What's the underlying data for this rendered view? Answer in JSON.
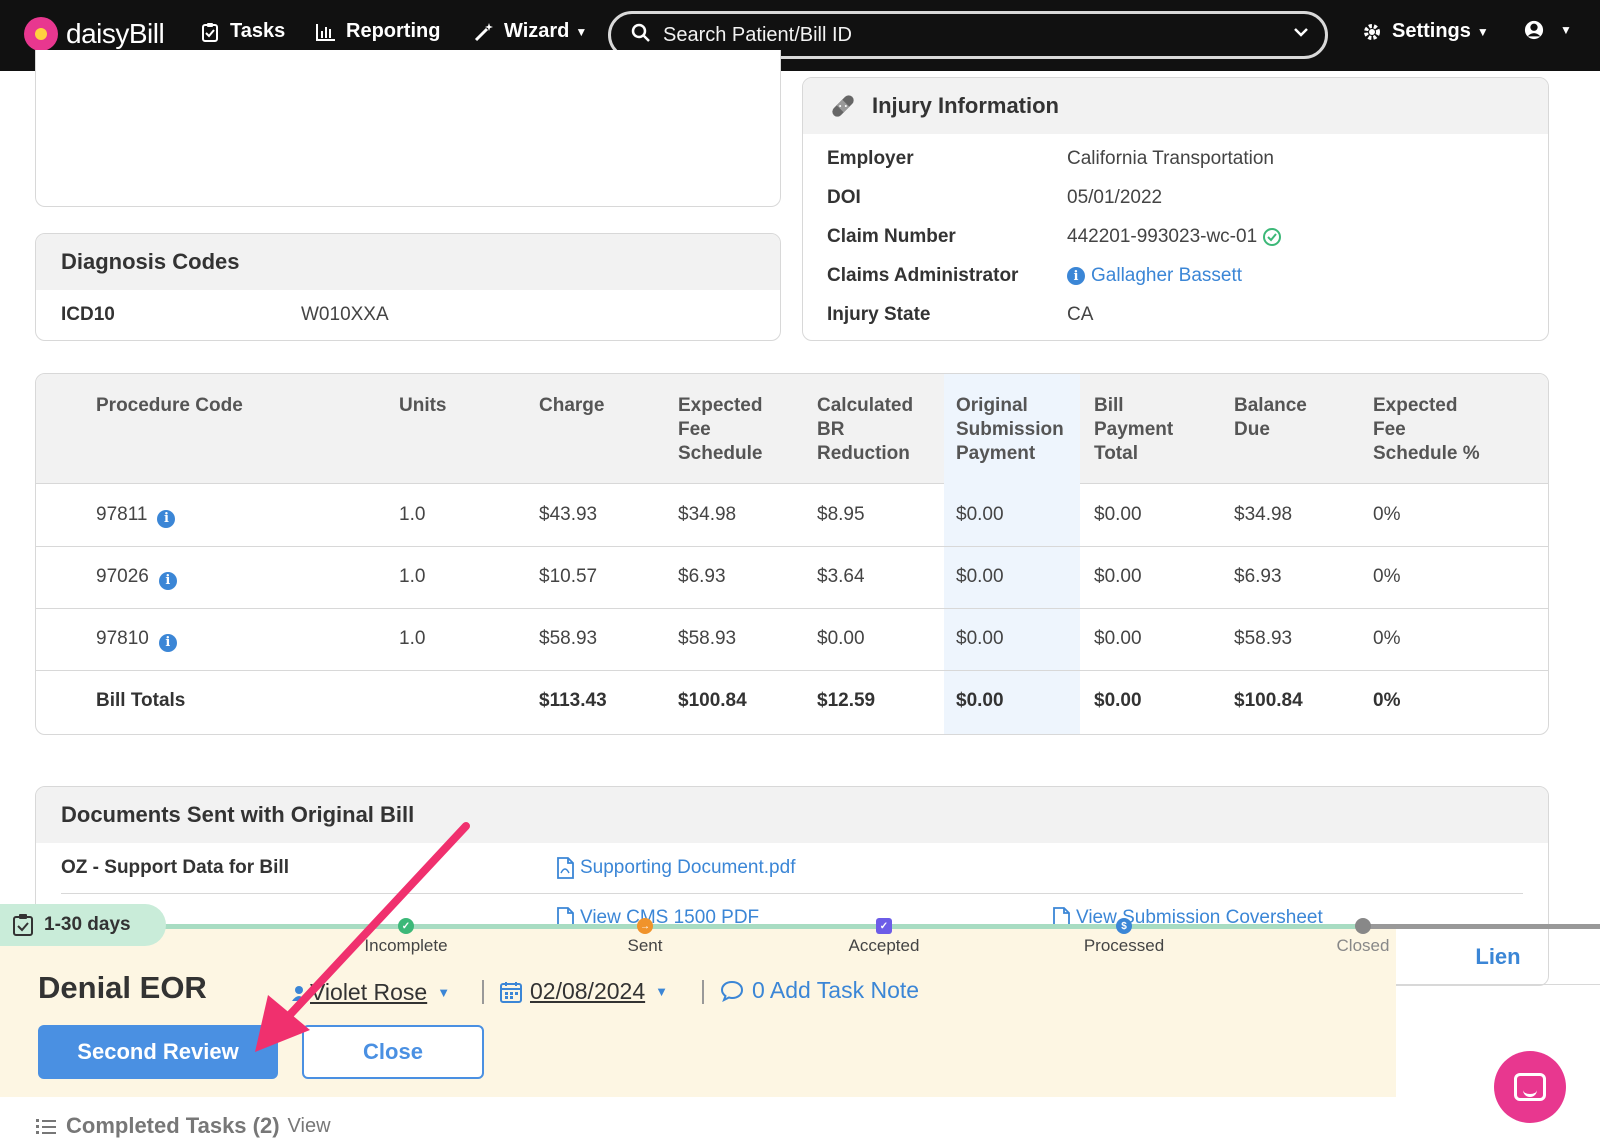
{
  "nav": {
    "brand": "daisyBill",
    "tasks": "Tasks",
    "reporting": "Reporting",
    "wizard": "Wizard",
    "search_placeholder": "Search Patient/Bill ID",
    "settings": "Settings"
  },
  "diagnosis": {
    "title": "Diagnosis Codes",
    "code_type": "ICD10",
    "code": "W010XXA"
  },
  "injury": {
    "title": "Injury Information",
    "rows": [
      {
        "label": "Employer",
        "value": "California Transportation"
      },
      {
        "label": "DOI",
        "value": "05/01/2022"
      },
      {
        "label": "Claim Number",
        "value": "442201-993023-wc-01"
      },
      {
        "label": "Claims Administrator",
        "value": "Gallagher Bassett"
      },
      {
        "label": "Injury State",
        "value": "CA"
      }
    ]
  },
  "procedures": {
    "headers": {
      "code": "Procedure Code",
      "units": "Units",
      "charge": "Charge",
      "expected_fee": [
        "Expected",
        "Fee",
        "Schedule"
      ],
      "br_reduction": [
        "Calculated",
        "BR",
        "Reduction"
      ],
      "original_payment": [
        "Original",
        "Submission",
        "Payment"
      ],
      "payment_total": [
        "Bill",
        "Payment",
        "Total"
      ],
      "balance_due": [
        "Balance",
        "Due"
      ],
      "expected_pct": [
        "Expected",
        "Fee",
        "Schedule %"
      ]
    },
    "rows": [
      {
        "code": "97811",
        "units": "1.0",
        "charge": "$43.93",
        "expected_fee": "$34.98",
        "br_reduction": "$8.95",
        "original_payment": "$0.00",
        "payment_total": "$0.00",
        "balance_due": "$34.98",
        "expected_pct": "0%"
      },
      {
        "code": "97026",
        "units": "1.0",
        "charge": "$10.57",
        "expected_fee": "$6.93",
        "br_reduction": "$3.64",
        "original_payment": "$0.00",
        "payment_total": "$0.00",
        "balance_due": "$6.93",
        "expected_pct": "0%"
      },
      {
        "code": "97810",
        "units": "1.0",
        "charge": "$58.93",
        "expected_fee": "$58.93",
        "br_reduction": "$0.00",
        "original_payment": "$0.00",
        "payment_total": "$0.00",
        "balance_due": "$58.93",
        "expected_pct": "0%"
      }
    ],
    "totals": {
      "label": "Bill Totals",
      "charge": "$113.43",
      "expected_fee": "$100.84",
      "br_reduction": "$12.59",
      "original_payment": "$0.00",
      "payment_total": "$0.00",
      "balance_due": "$100.84",
      "expected_pct": "0%"
    }
  },
  "documents": {
    "title": "Documents Sent with Original Bill",
    "row_label": "OZ - Support Data for Bill",
    "supporting_doc": "Supporting Document.pdf",
    "cms_link": "View CMS 1500 PDF",
    "coversheet_link": "View Submission Coversheet"
  },
  "progress": {
    "days": "1-30 days",
    "steps": [
      "Incomplete",
      "Sent",
      "Accepted",
      "Processed",
      "Closed"
    ]
  },
  "task": {
    "title": "Denial EOR",
    "assignee": "Violet Rose",
    "date": "02/08/2024",
    "note": "0 Add Task Note",
    "primary_button": "Second Review",
    "secondary_button": "Close",
    "side_tab": "Lien"
  },
  "completed": {
    "label": "Completed Tasks (2)",
    "view": "View"
  },
  "colors": {
    "nav_bg": "#111111",
    "accent": "#4a90e2",
    "annotation_arrow": "#f0306e",
    "task_bg": "#fdf6e3",
    "chat": "#e8378f"
  }
}
